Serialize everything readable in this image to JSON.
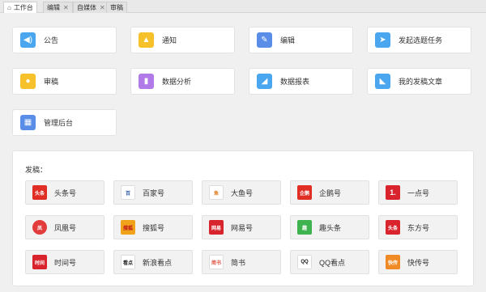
{
  "tabs": [
    {
      "label": "工作台",
      "active": true,
      "closable": false
    },
    {
      "label": "编辑",
      "active": false,
      "closable": true
    },
    {
      "label": "自媒体",
      "active": false,
      "closable": true
    },
    {
      "label": "审稿",
      "active": false,
      "closable": false
    }
  ],
  "cards": [
    {
      "label": "公告",
      "icon": "speaker-icon",
      "color": "#4aa7ef"
    },
    {
      "label": "通知",
      "icon": "bell-icon",
      "color": "#f6c12a"
    },
    {
      "label": "编辑",
      "icon": "pencil-icon",
      "color": "#5a8de8"
    },
    {
      "label": "发起选题任务",
      "icon": "send-icon",
      "color": "#4aa7ef"
    },
    {
      "label": "审稿",
      "icon": "user-review-icon",
      "color": "#f6c12a"
    },
    {
      "label": "数据分析",
      "icon": "bar-chart-icon",
      "color": "#b07be8"
    },
    {
      "label": "数据报表",
      "icon": "area-chart-icon",
      "color": "#4aa7ef"
    },
    {
      "label": "我的发稿文章",
      "icon": "line-chart-icon",
      "color": "#4aa7ef"
    },
    {
      "label": "管理后台",
      "icon": "grid-icon",
      "color": "#5a8de8"
    }
  ],
  "platforms": {
    "title": "发稿：",
    "items": [
      {
        "label": "头条号",
        "logo_text": "头条",
        "logo_color": "#e02e24",
        "icon": "toutiao-logo-icon"
      },
      {
        "label": "百家号",
        "logo_text": "百",
        "logo_color": "#ffffff",
        "icon": "baijia-logo-icon"
      },
      {
        "label": "大鱼号",
        "logo_text": "鱼",
        "logo_color": "#ffffff",
        "icon": "dayu-logo-icon"
      },
      {
        "label": "企鹅号",
        "logo_text": "企鹅",
        "logo_color": "#e02e24",
        "icon": "penguin-logo-icon"
      },
      {
        "label": "一点号",
        "logo_text": "1.",
        "logo_color": "#d9232d",
        "icon": "yidian-logo-icon"
      },
      {
        "label": "凤凰号",
        "logo_text": "凤",
        "logo_color": "#e23b3b",
        "icon": "phoenix-logo-icon"
      },
      {
        "label": "搜狐号",
        "logo_text": "搜狐",
        "logo_color": "#f0a21a",
        "icon": "sohu-logo-icon"
      },
      {
        "label": "网易号",
        "logo_text": "网易",
        "logo_color": "#d8242c",
        "icon": "netease-logo-icon"
      },
      {
        "label": "趣头条",
        "logo_text": "趣",
        "logo_color": "#3fb34f",
        "icon": "qutoutiao-logo-icon"
      },
      {
        "label": "东方号",
        "logo_text": "头条",
        "logo_color": "#d9232d",
        "icon": "dongfang-logo-icon"
      },
      {
        "label": "时间号",
        "logo_text": "时间",
        "logo_color": "#d9232d",
        "icon": "shijian-logo-icon"
      },
      {
        "label": "新浪看点",
        "logo_text": "看点",
        "logo_color": "#ffffff",
        "icon": "sina-logo-icon"
      },
      {
        "label": "简书",
        "logo_text": "简书",
        "logo_color": "#ffffff",
        "icon": "jianshu-logo-icon"
      },
      {
        "label": "QQ看点",
        "logo_text": "QQ",
        "logo_color": "#ffffff",
        "icon": "qq-logo-icon"
      },
      {
        "label": "快传号",
        "logo_text": "快传",
        "logo_color": "#f08a24",
        "icon": "kuaichuan-logo-icon"
      }
    ]
  }
}
